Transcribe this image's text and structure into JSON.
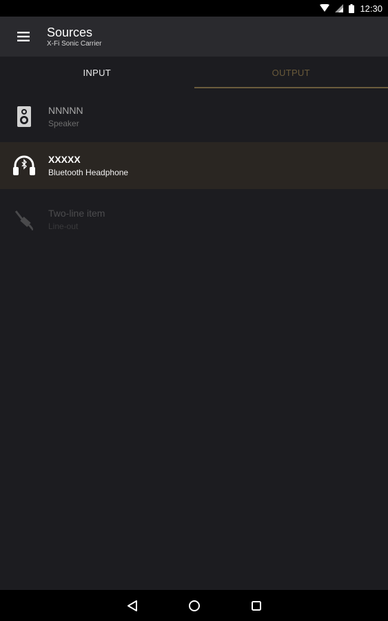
{
  "status_bar": {
    "time": "12:30",
    "icons": [
      "wifi-icon",
      "signal-icon",
      "battery-icon"
    ]
  },
  "app_bar": {
    "title": "Sources",
    "subtitle": "X-Fi Sonic Carrier",
    "menu_icon": "hamburger-menu-icon"
  },
  "tabs": [
    {
      "label": "INPUT",
      "selected": false
    },
    {
      "label": "OUTPUT",
      "selected": true
    }
  ],
  "outputs": [
    {
      "primary": "NNNNN",
      "secondary": "Speaker",
      "icon": "speaker-icon",
      "state": "normal"
    },
    {
      "primary": "XXXXX",
      "secondary": "Bluetooth Headphone",
      "icon": "bluetooth-headphone-icon",
      "state": "selected"
    },
    {
      "primary": "Two-line item",
      "secondary": "Line-out",
      "icon": "line-out-cable-icon",
      "state": "disabled"
    }
  ],
  "colors": {
    "background": "#1c1c20",
    "app_bar": "#2a2a2e",
    "accent": "#6b5c3d",
    "selected_row": "#2a2622"
  },
  "nav_bar": {
    "buttons": [
      "back-icon",
      "home-icon",
      "recents-icon"
    ]
  }
}
